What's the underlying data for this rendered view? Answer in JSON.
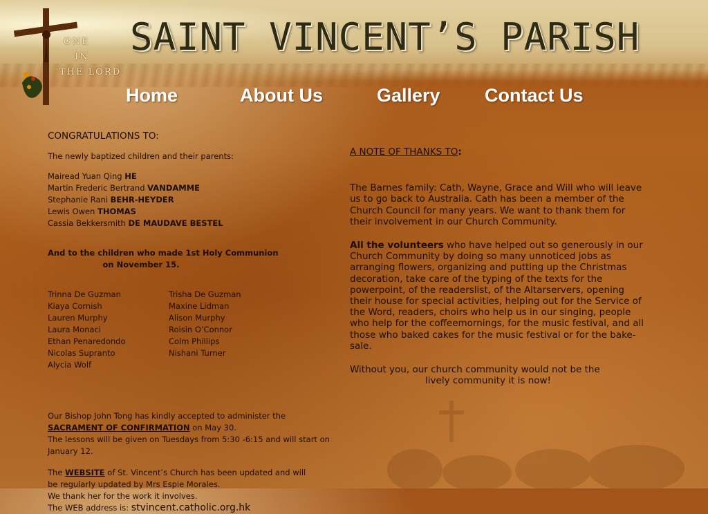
{
  "header": {
    "title": "SAINT VINCENT’S PARISH",
    "motto": [
      "ONE",
      "IN",
      "THE LORD"
    ]
  },
  "nav": [
    {
      "label": "Home"
    },
    {
      "label": "About Us"
    },
    {
      "label": "Gallery"
    },
    {
      "label": "Contact Us"
    }
  ],
  "congratulations": {
    "heading": "CONGRATULATIONS TO:",
    "intro": "The newly baptized children and their parents:",
    "baptized": [
      {
        "given": "Mairead Yuan Qing",
        "surname": "HE"
      },
      {
        "given": "Martin Frederic Bertrand",
        "surname": "VANDAMME"
      },
      {
        "given": "Stephanie Rani",
        "surname": "BEHR-HEYDER"
      },
      {
        "given": "Lewis Owen",
        "surname": "THOMAS"
      },
      {
        "given": "Cassia Bekkersmith",
        "surname": "DE MAUDAVE BESTEL"
      }
    ],
    "communion_line1": "And to the children who made 1st Holy Communion",
    "communion_line2": "on November 15.",
    "communion_col1": [
      "Trinna De Guzman",
      "Kiaya Cornish",
      "Lauren Murphy",
      "Laura Monaci",
      "Ethan Penaredondo",
      "Nicolas Supranto",
      "Alycia Wolf"
    ],
    "communion_col2": [
      "Trisha De Guzman",
      "Maxine Lidman",
      "Alison Murphy",
      "Roisin O’Connor",
      "Colm Phillips",
      "Nishani Turner"
    ]
  },
  "confirmation": {
    "line1": "Our Bishop John Tong has kindly accepted to administer the",
    "link": "SACRAMENT OF CONFIRMATION",
    "after_link": " on May 30.",
    "line3": "The lessons will be given on Tuesdays from 5:30 -6:15 and will start on January 12."
  },
  "website": {
    "pre": "The ",
    "link": "WEBSITE",
    "post": " of St. Vincent’s Church has been updated and will be regularly updated by Mrs Espie Morales.",
    "thanks": "We thank her for the work it involves.",
    "address_label": "The WEB address is: ",
    "address": "stvincent.catholic.org.hk"
  },
  "thanks": {
    "heading": "A NOTE OF THANKS TO",
    "colon": ":",
    "barnes": "The Barnes family: Cath, Wayne, Grace and Will who will leave us to go back to Australia. Cath has been a member of the Church Council for many years. We want to thank them for their involvement in our Church Community.",
    "volunteers_bold": "All the volunteers",
    "volunteers_text": " who have helped out so generously in our Church Community by doing so many unnoticed jobs as arranging flowers, organizing and putting up the Christmas decoration, take care of the typing of the texts for the powerpoint, of the readerslist, of the Altarservers, opening their house for special activities, helping out for the Service of the Word, readers, choirs who help us in our singing, people who help for the coffeemornings, for the music festival, and all those who baked cakes for the music festival or for the bake-sale.",
    "closing1": "Without you, our church community would not be the",
    "closing2": "lively community it is now!"
  },
  "colors": {
    "background": "#a85a1b",
    "banner": "#d9c28d",
    "nav_text": "#ffffff",
    "body_text": "#1c0d02"
  }
}
